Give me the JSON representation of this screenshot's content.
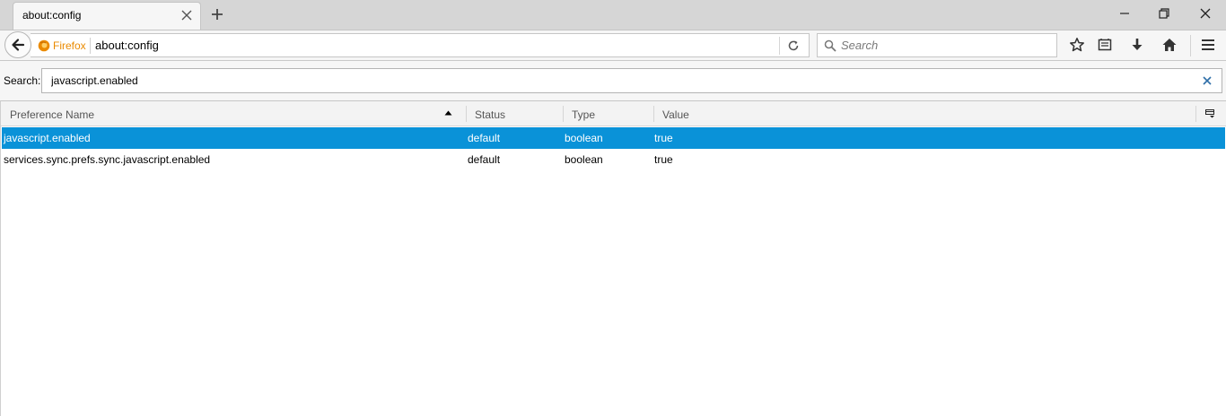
{
  "tab": {
    "title": "about:config"
  },
  "nav": {
    "identity_label": "Firefox",
    "url": "about:config",
    "search_placeholder": "Search"
  },
  "config": {
    "search_label": "Search:",
    "search_value": "javascript.enabled",
    "columns": [
      "Preference Name",
      "Status",
      "Type",
      "Value"
    ],
    "sort_column": "Preference Name",
    "rows": [
      {
        "name": "javascript.enabled",
        "status": "default",
        "type": "boolean",
        "value": "true",
        "selected": true
      },
      {
        "name": "services.sync.prefs.sync.javascript.enabled",
        "status": "default",
        "type": "boolean",
        "value": "true",
        "selected": false
      }
    ]
  },
  "colors": {
    "selection": "#0a92d8",
    "firefox_orange": "#ea8a00",
    "chrome_bg": "#f6f6f6",
    "tabstrip_bg": "#d6d6d6"
  },
  "icons": {
    "tab_close": "close-icon",
    "new_tab": "plus-icon",
    "minimize": "minimize-icon",
    "restore": "restore-icon",
    "window_close": "close-icon",
    "back": "back-arrow-icon",
    "identity": "firefox-logo-icon",
    "reload": "reload-icon",
    "search": "search-icon",
    "bookmark": "star-icon",
    "library": "bookmarks-list-icon",
    "downloads": "download-arrow-icon",
    "home": "home-icon",
    "menu": "hamburger-menu-icon",
    "clear_filter": "close-icon",
    "sort": "sort-up-arrow-icon",
    "column_picker": "column-picker-icon"
  }
}
